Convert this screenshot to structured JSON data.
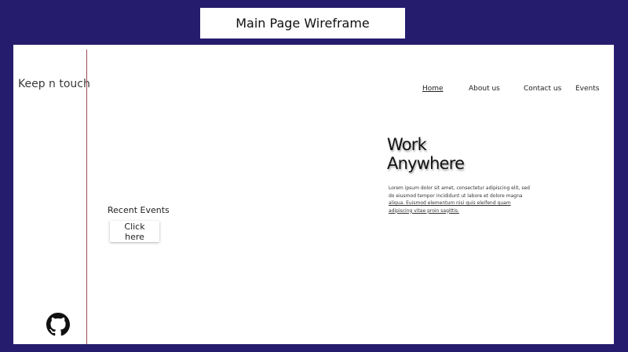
{
  "window": {
    "title": "Main Page Wireframe"
  },
  "sidebar": {
    "brand": "Keep n touch",
    "footer_icon": "github-icon"
  },
  "nav": {
    "items": [
      {
        "label": "Home",
        "active": true
      },
      {
        "label": "About us",
        "active": false
      },
      {
        "label": "Contact us",
        "active": false
      },
      {
        "label": "Events",
        "active": false
      }
    ]
  },
  "hero": {
    "title_line1": "Work",
    "title_line2": "Anywhere",
    "body_lines": [
      "Lorem ipsum dolor sit amet, consectetur adipiscing elit, sed",
      "do eiusmod tempor incididunt ut labore et dolore magna",
      "aliqua. Euismod elementum nisi quis eleifend quam",
      "adipiscing vitae proin sagittis."
    ]
  },
  "events": {
    "heading": "Recent Events",
    "button_label": "Click here"
  },
  "colors": {
    "background": "#261c6e",
    "divider": "#9a4a5c",
    "page": "#ffffff"
  }
}
